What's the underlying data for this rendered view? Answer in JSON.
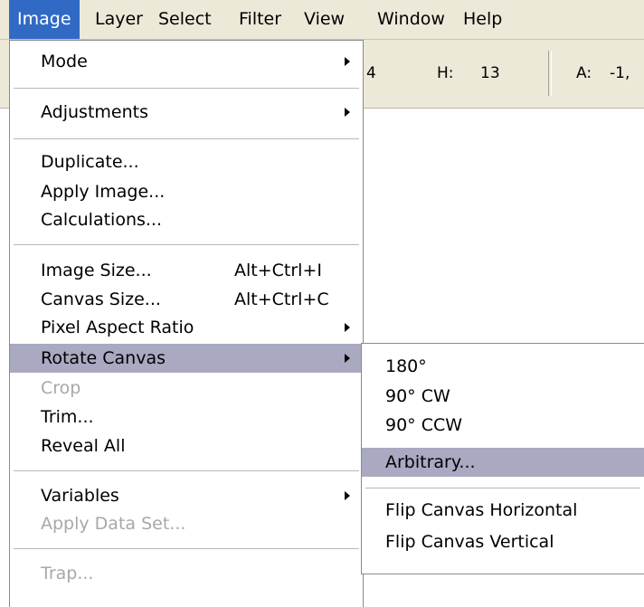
{
  "menubar": {
    "items": [
      "Image",
      "Layer",
      "Select",
      "Filter",
      "View",
      "Window",
      "Help"
    ]
  },
  "options_bar": {
    "partial_value": "4",
    "h_label": "H:",
    "h_value": "13",
    "a_label": "A:",
    "a_value": "-1,"
  },
  "image_menu": {
    "mode": "Mode",
    "adjustments": "Adjustments",
    "duplicate": "Duplicate...",
    "apply_image": "Apply Image...",
    "calculations": "Calculations...",
    "image_size": "Image Size...",
    "image_size_shortcut": "Alt+Ctrl+I",
    "canvas_size": "Canvas Size...",
    "canvas_size_shortcut": "Alt+Ctrl+C",
    "pixel_aspect_ratio": "Pixel Aspect Ratio",
    "rotate_canvas": "Rotate Canvas",
    "crop": "Crop",
    "trim": "Trim...",
    "reveal_all": "Reveal All",
    "variables": "Variables",
    "apply_data_set": "Apply Data Set...",
    "trap": "Trap..."
  },
  "rotate_submenu": {
    "rotate_180": "180°",
    "rotate_90_cw": "90° CW",
    "rotate_90_ccw": "90° CCW",
    "arbitrary": "Arbitrary...",
    "flip_horizontal": "Flip Canvas Horizontal",
    "flip_vertical": "Flip Canvas Vertical"
  },
  "colors": {
    "menubar_bg": "#ece9d8",
    "active_menu_bg": "#316ac5",
    "highlight_bg": "#a9a9c2",
    "disabled_text": "#a8a8a8"
  }
}
